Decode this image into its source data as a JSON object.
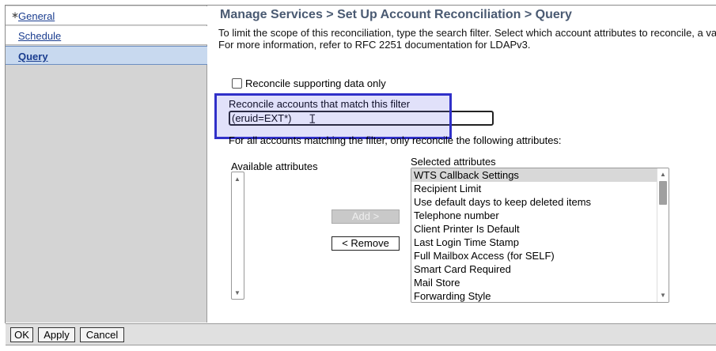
{
  "nav": {
    "items": [
      {
        "label": "General",
        "marker": "∗"
      },
      {
        "label": "Schedule"
      },
      {
        "label": "Query"
      }
    ]
  },
  "main": {
    "title": "Manage Services > Set Up Account Reconciliation > Query",
    "description": "To limit the scope of this reconciliation, type the search filter. Select which account attributes to reconcile, a valid LDAP filter. For more information, refer to RFC 2251 documentation for LDAPv3.",
    "supporting_data_label": "Reconcile supporting data only",
    "filter_label": "Reconcile accounts that match this filter",
    "filter_value": "(eruid=EXT*)",
    "attributes_note": "For all accounts matching the filter, only reconcile the following attributes:",
    "available_label": "Available attributes",
    "add_label": "Add >",
    "remove_label": "< Remove",
    "selected_label": "Selected attributes",
    "selected_items": [
      "WTS Callback Settings",
      "Recipient Limit",
      "Use default days to keep deleted items",
      "Telephone number",
      "Client Printer Is Default",
      "Last Login Time Stamp",
      "Full Mailbox Access (for SELF)",
      "Smart Card Required",
      "Mail Store",
      "Forwarding Style"
    ]
  },
  "footer": {
    "ok_label": "OK",
    "apply_label": "Apply",
    "cancel_label": "Cancel"
  },
  "colors": {
    "highlight_border": "#3030c8",
    "title_color": "#4a5a72",
    "link_color": "#1a3d8f"
  }
}
